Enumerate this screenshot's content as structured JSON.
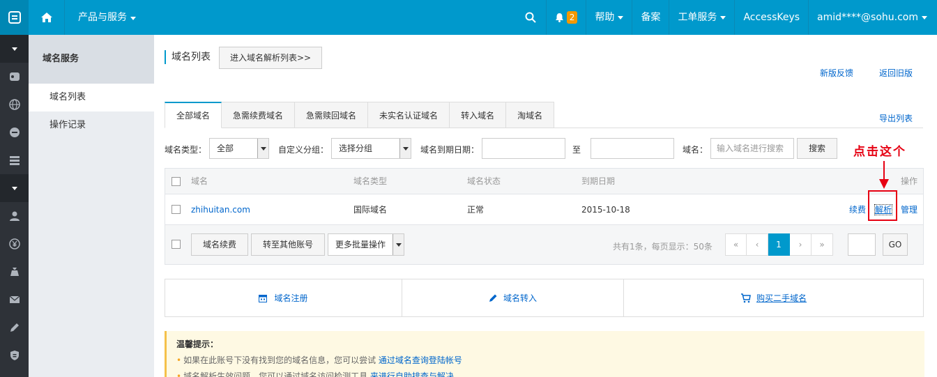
{
  "topbar": {
    "products": "产品与服务",
    "notifications_count": "2",
    "help": "帮助",
    "beian": "备案",
    "tickets": "工单服务",
    "accesskeys": "AccessKeys",
    "account": "amid****@sohu.com"
  },
  "subnav": {
    "title": "域名服务",
    "items": [
      {
        "label": "域名列表"
      },
      {
        "label": "操作记录"
      }
    ]
  },
  "page": {
    "title": "域名列表",
    "dns_list_button": "进入域名解析列表>>",
    "feedback_link": "新版反馈",
    "old_version_link": "返回旧版",
    "export_link": "导出列表"
  },
  "tabs": [
    {
      "label": "全部域名"
    },
    {
      "label": "急需续费域名"
    },
    {
      "label": "急需赎回域名"
    },
    {
      "label": "未实名认证域名"
    },
    {
      "label": "转入域名"
    },
    {
      "label": "淘域名"
    }
  ],
  "filter": {
    "type_label": "域名类型：",
    "type_value": "全部",
    "group_label": "自定义分组：",
    "group_value": "选择分组",
    "date_label": "域名到期日期：",
    "to_label": "至",
    "domain_label": "域名：",
    "domain_placeholder": "输入域名进行搜索",
    "search_button": "搜索"
  },
  "table": {
    "headers": {
      "domain": "域名",
      "type": "域名类型",
      "status": "域名状态",
      "expiry": "到期日期",
      "actions": "操作"
    },
    "rows": [
      {
        "domain": "zhihuitan.com",
        "type": "国际域名",
        "status": "正常",
        "expiry": "2015-10-18",
        "renew": "续费",
        "resolve": "解析",
        "manage": "管理"
      }
    ],
    "footer": {
      "renew_button": "域名续费",
      "transfer_button": "转至其他账号",
      "batch_select": "更多批量操作",
      "summary": "共有1条，每页显示：50条",
      "pages": [
        "«",
        "‹",
        "1",
        "›",
        "»"
      ],
      "go_button": "GO"
    }
  },
  "quick_actions": {
    "register": "域名注册",
    "transfer_in": "域名转入",
    "buy_second_hand": "购买二手域名"
  },
  "tips": {
    "title": "温馨提示：",
    "line1_text": "如果在此账号下没有找到您的域名信息，您可以尝试",
    "line1_link": "通过域名查询登陆帐号",
    "line2_text": "域名解析生效问题，您可以通过域名访问检测工具",
    "line2_link": "来进行自助排查与解决"
  },
  "annotation": {
    "text": "点击这个"
  },
  "colors": {
    "primary": "#0099cc",
    "link": "#0066cc",
    "annotation": "#e60012"
  }
}
